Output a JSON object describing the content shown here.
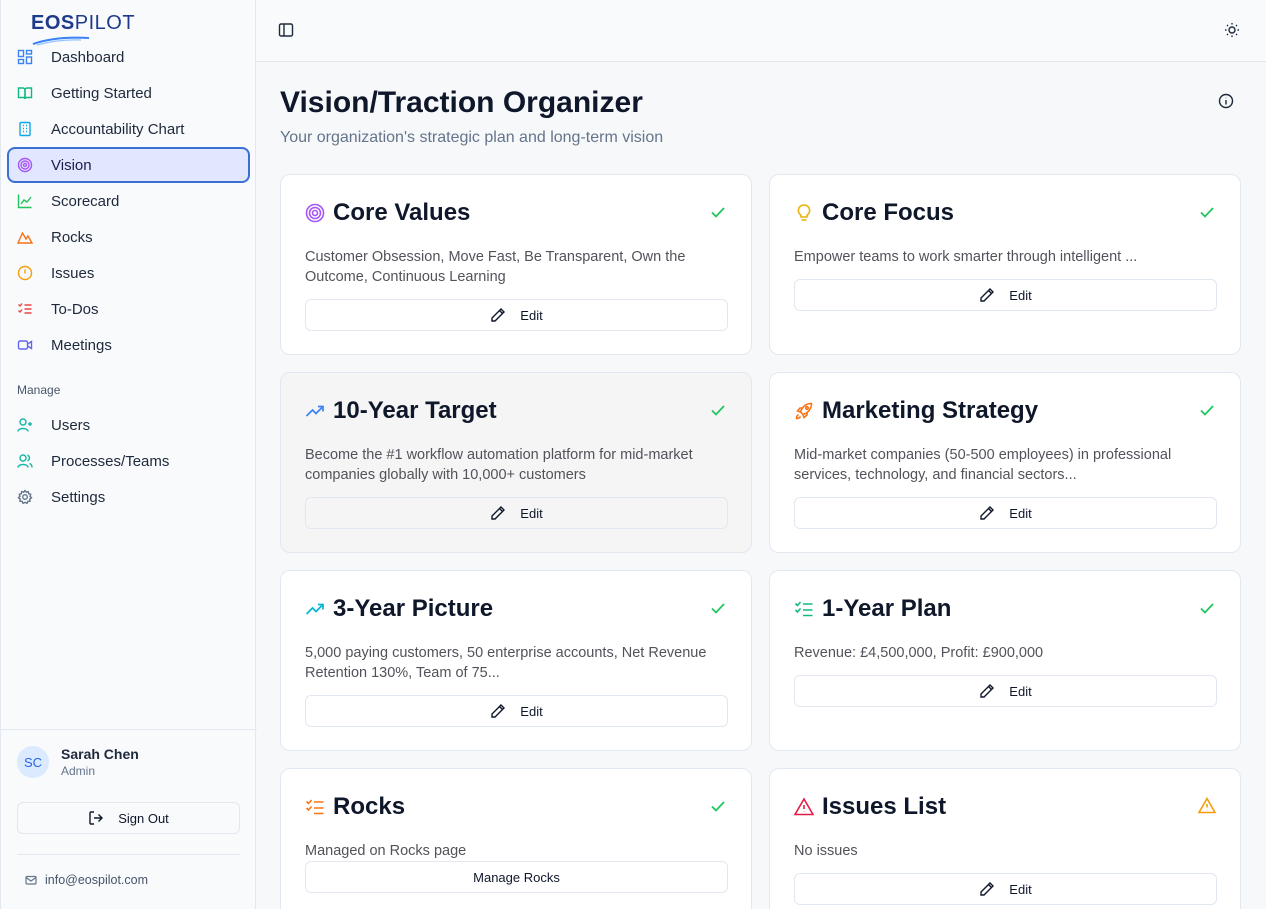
{
  "brand": {
    "logo_bold": "EOS",
    "logo_light": "PILOT"
  },
  "sidebar": {
    "items": [
      {
        "label": "Dashboard",
        "icon": "dashboard-icon"
      },
      {
        "label": "Getting Started",
        "icon": "book-icon"
      },
      {
        "label": "Accountability Chart",
        "icon": "building-icon"
      },
      {
        "label": "Vision",
        "icon": "target-icon"
      },
      {
        "label": "Scorecard",
        "icon": "chart-line-icon"
      },
      {
        "label": "Rocks",
        "icon": "mountain-icon"
      },
      {
        "label": "Issues",
        "icon": "alert-circle-icon"
      },
      {
        "label": "To-Dos",
        "icon": "list-todo-icon"
      },
      {
        "label": "Meetings",
        "icon": "video-icon"
      }
    ],
    "manage_label": "Manage",
    "manage_items": [
      {
        "label": "Users",
        "icon": "user-plus-icon"
      },
      {
        "label": "Processes/Teams",
        "icon": "users-icon"
      },
      {
        "label": "Settings",
        "icon": "gear-icon"
      }
    ],
    "user": {
      "initials": "SC",
      "name": "Sarah Chen",
      "role": "Admin"
    },
    "signout_label": "Sign Out",
    "email": "info@eospilot.com"
  },
  "page": {
    "title": "Vision/Traction Organizer",
    "subtitle": "Your organization's strategic plan and long-term vision"
  },
  "cards": [
    {
      "title": "Core Values",
      "text": "Customer Obsession, Move Fast, Be Transparent, Own the Outcome, Continuous Learning",
      "button": "Edit",
      "status": "complete"
    },
    {
      "title": "Core Focus",
      "text": "Empower teams to work smarter through intelligent ...",
      "button": "Edit",
      "status": "complete"
    },
    {
      "title": "10-Year Target",
      "text": "Become the #1 workflow automation platform for mid-market companies globally with 10,000+ customers",
      "button": "Edit",
      "status": "complete"
    },
    {
      "title": "Marketing Strategy",
      "text": "Mid-market companies (50-500 employees) in professional services, technology, and financial sectors...",
      "button": "Edit",
      "status": "complete"
    },
    {
      "title": "3-Year Picture",
      "text": "5,000 paying customers, 50 enterprise accounts, Net Revenue Retention 130%, Team of 75...",
      "button": "Edit",
      "status": "complete"
    },
    {
      "title": "1-Year Plan",
      "text": "Revenue: £4,500,000, Profit: £900,000",
      "button": "Edit",
      "status": "complete"
    },
    {
      "title": "Rocks",
      "text": "Managed on Rocks page",
      "button": "Manage Rocks",
      "status": "complete"
    },
    {
      "title": "Issues List",
      "text": "No issues",
      "button": "Edit",
      "status": "warning"
    }
  ],
  "colors": {
    "accent": "#3b6fd4",
    "check": "#22c55e",
    "warning": "#f59e0b"
  }
}
